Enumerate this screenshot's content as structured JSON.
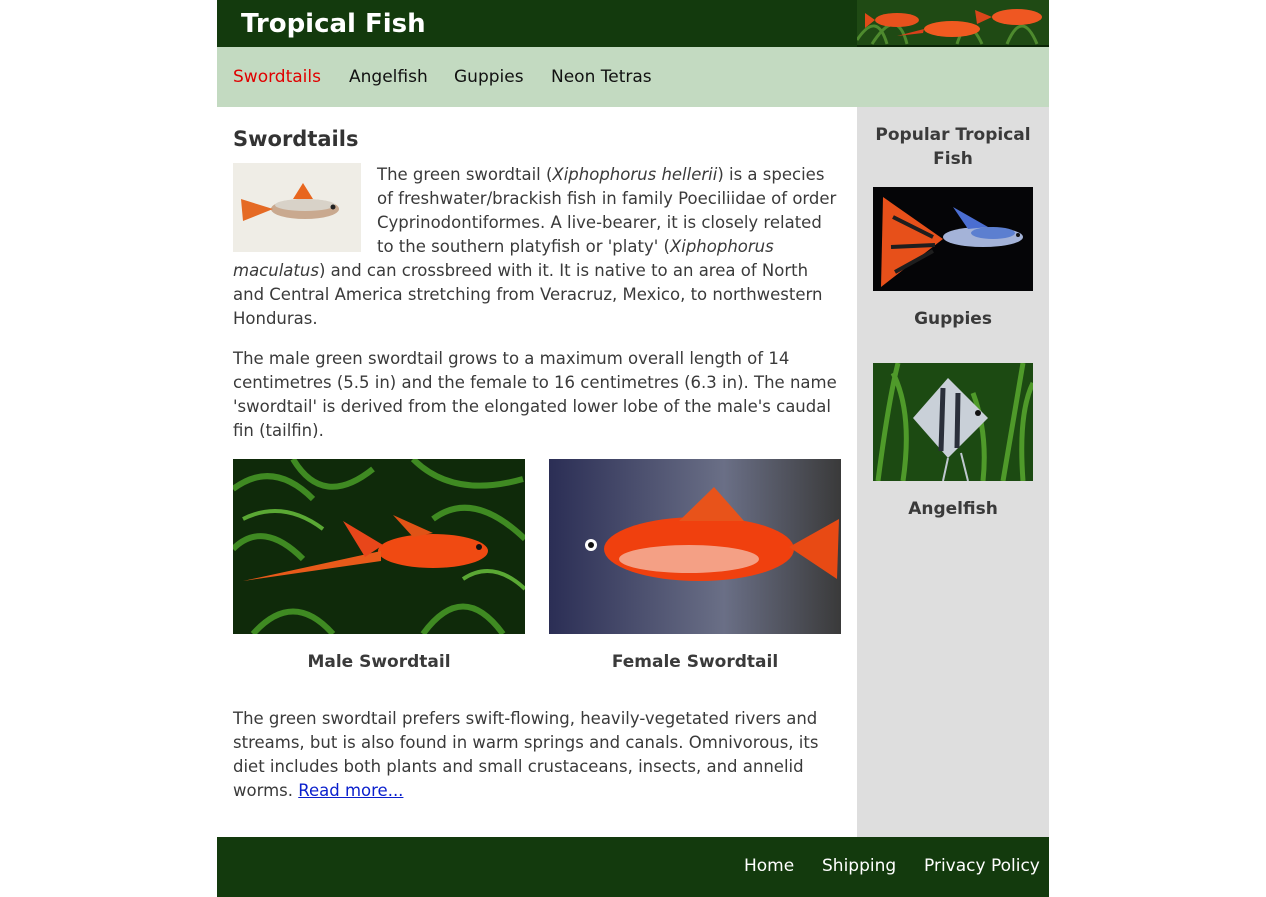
{
  "site": {
    "title": "Tropical Fish"
  },
  "nav": {
    "items": [
      {
        "label": "Swordtails",
        "active": true
      },
      {
        "label": "Angelfish",
        "active": false
      },
      {
        "label": "Guppies",
        "active": false
      },
      {
        "label": "Neon Tetras",
        "active": false
      }
    ]
  },
  "main": {
    "heading": "Swordtails",
    "p1": {
      "t1": "The green swordtail (",
      "i1": "Xiphophorus hellerii",
      "t2": ") is a species of freshwater/brackish fish in family Poeciliidae of order Cyprinodontiformes. A live-bearer, it is closely related to the southern platyfish or 'platy' (",
      "i2": "Xiphophorus maculatus",
      "t3": ") and can crossbreed with it. It is native to an area of North and Central America stretching from Veracruz, Mexico, to northwestern Honduras."
    },
    "p2": "The male green swordtail grows to a maximum overall length of 14 centimetres (5.5 in) and the female to 16 centimetres (6.3 in). The name 'swordtail' is derived from the elongated lower lobe of the male's caudal fin (tailfin).",
    "figures": {
      "male_caption": "Male Swordtail",
      "female_caption": "Female Swordtail"
    },
    "p3": {
      "text": "The green swordtail prefers swift-flowing, heavily-vegetated rivers and streams, but is also found in warm springs and canals. Omnivorous, its diet includes both plants and small crustaceans, insects, and annelid worms. ",
      "link": "Read more..."
    }
  },
  "sidebar": {
    "heading": "Popular Tropical Fish",
    "items": [
      {
        "caption": "Guppies"
      },
      {
        "caption": "Angelfish"
      }
    ]
  },
  "footer": {
    "links": [
      "Home",
      "Shipping",
      "Privacy Policy"
    ]
  },
  "colors": {
    "header_bg": "#133a0d",
    "nav_bg": "#c3dac1",
    "active_nav": "#e00000",
    "sidebar_bg": "#dedede",
    "link": "#0a1fcc"
  }
}
